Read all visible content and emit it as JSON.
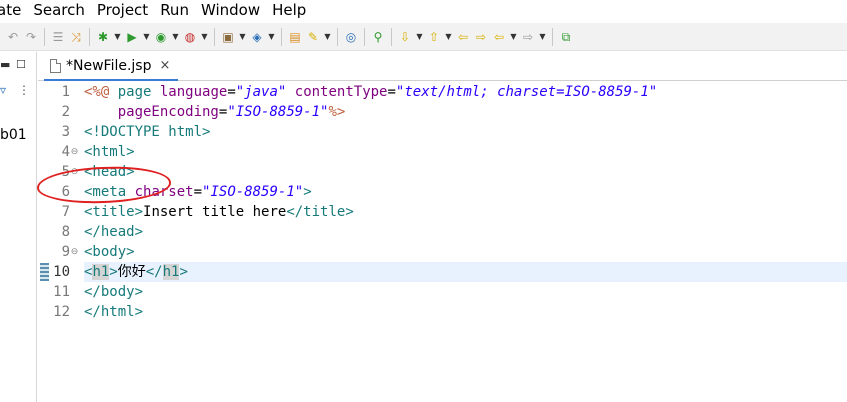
{
  "menu": [
    "ate",
    "Search",
    "Project",
    "Run",
    "Window",
    "Help"
  ],
  "left_panel": {
    "project_label": "b01"
  },
  "editor_tab": {
    "label": "*NewFile.jsp",
    "close": "×"
  },
  "code": {
    "current_line": 10,
    "lines": [
      {
        "num": "1",
        "fold": ""
      },
      {
        "num": "2",
        "fold": ""
      },
      {
        "num": "3",
        "fold": ""
      },
      {
        "num": "4",
        "fold": "⊖"
      },
      {
        "num": "5",
        "fold": "⊖"
      },
      {
        "num": "6",
        "fold": ""
      },
      {
        "num": "7",
        "fold": ""
      },
      {
        "num": "8",
        "fold": ""
      },
      {
        "num": "9",
        "fold": "⊖"
      },
      {
        "num": "10",
        "fold": ""
      },
      {
        "num": "11",
        "fold": ""
      },
      {
        "num": "12",
        "fold": ""
      }
    ],
    "tokens": {
      "l1": {
        "open": "<%@",
        "kw": " page ",
        "a1": "language",
        "eq1": "=",
        "v1": "\"java\"",
        "sp1": " ",
        "a2": "contentType",
        "eq2": "=",
        "v2": "\"text/html; charset=ISO-8859-1\""
      },
      "l2": {
        "indent": "    ",
        "a1": "pageEncoding",
        "eq1": "=",
        "v1": "\"ISO-8859-1\"",
        "close": "%>"
      },
      "l3": {
        "doctype": "<!DOCTYPE",
        "rest": " html>"
      },
      "l4": {
        "tag": "<html>"
      },
      "l5": {
        "tag": "<head>"
      },
      "l6": {
        "open": "<meta",
        "sp": " ",
        "a1": "charset",
        "eq1": "=",
        "v1": "\"ISO-8859-1\"",
        "close": ">"
      },
      "l7": {
        "open": "<title>",
        "text": "Insert title here",
        "close": "</title>"
      },
      "l8": {
        "tag": "</head>"
      },
      "l9": {
        "tag": "<body>"
      },
      "l10": {
        "lt": "<",
        "h1": "h1",
        "gt": ">",
        "text": "你好",
        "lt2": "</",
        "h1b": "h1",
        "gt2": ">"
      },
      "l11": {
        "tag": "</body>"
      },
      "l12": {
        "tag": "</html>"
      }
    }
  },
  "colors": {
    "tag": "#177a7a",
    "attribute": "#7f007f",
    "string": "#2a00ff",
    "jsp_delimiter": "#bf5f3f",
    "annotation": "#e02020",
    "current_line": "#e8f2fe"
  },
  "toolbar_icons": [
    "undo-icon",
    "redo-icon",
    "tasks-icon",
    "link-icon",
    "debug-icon",
    "run-icon",
    "coverage-icon",
    "external-tools-icon",
    "new-server-icon",
    "new-project-icon",
    "open-type-icon",
    "search-icon",
    "globe-icon",
    "pin-icon",
    "next-annotation-icon",
    "prev-annotation-icon",
    "last-edit-icon",
    "next-edit-icon",
    "back-icon",
    "forward-icon",
    "open-perspective-icon"
  ]
}
